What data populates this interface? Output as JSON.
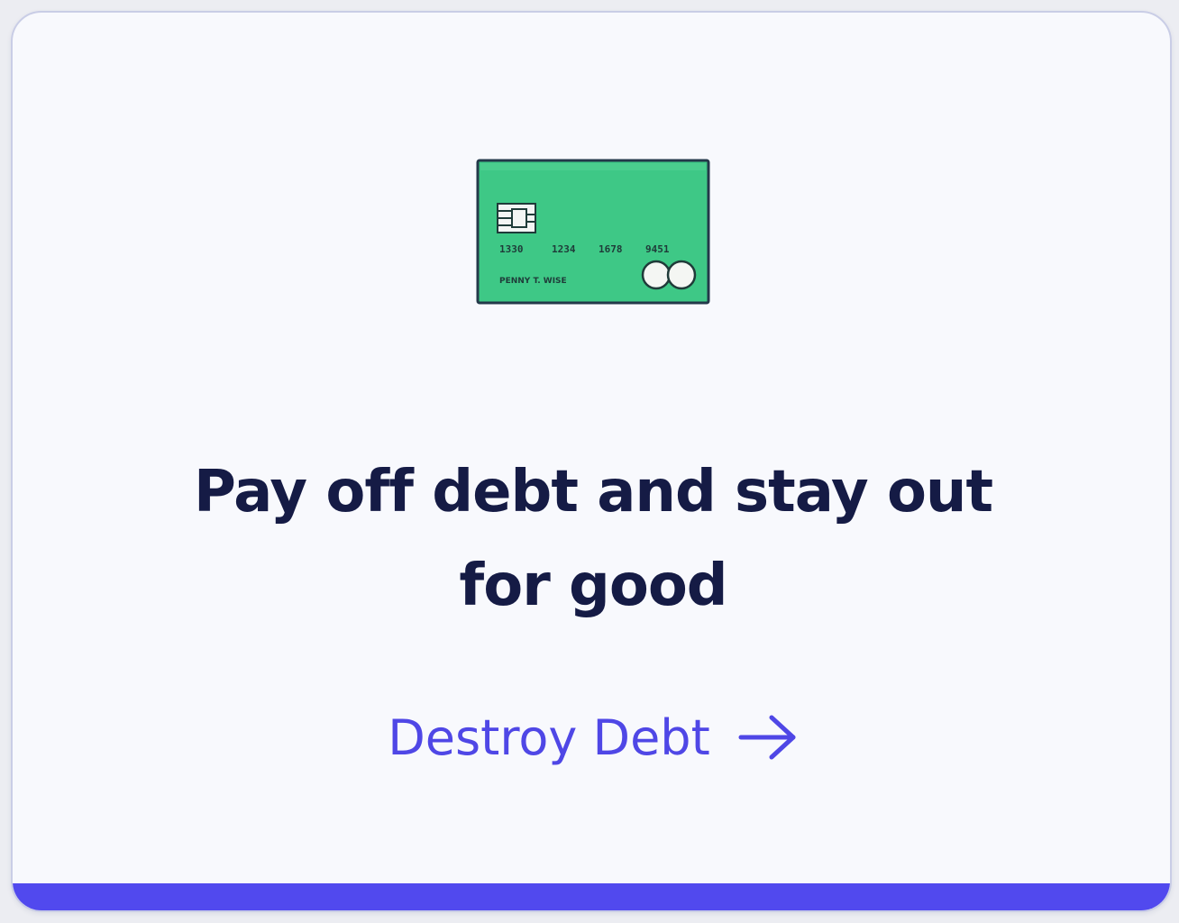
{
  "card": {
    "illustration": {
      "icon": "credit-card-icon",
      "card_color": "#3ec886",
      "number_groups": [
        "1330",
        "1234",
        "1678",
        "9451"
      ],
      "holder_name": "PENNY T. WISE"
    },
    "headline_line1": "Pay off debt and stay out",
    "headline_line2": "for good",
    "cta_label": "Destroy Debt",
    "cta_icon": "arrow-right-icon",
    "accent_color": "#5149ee",
    "text_color": "#151b45"
  }
}
